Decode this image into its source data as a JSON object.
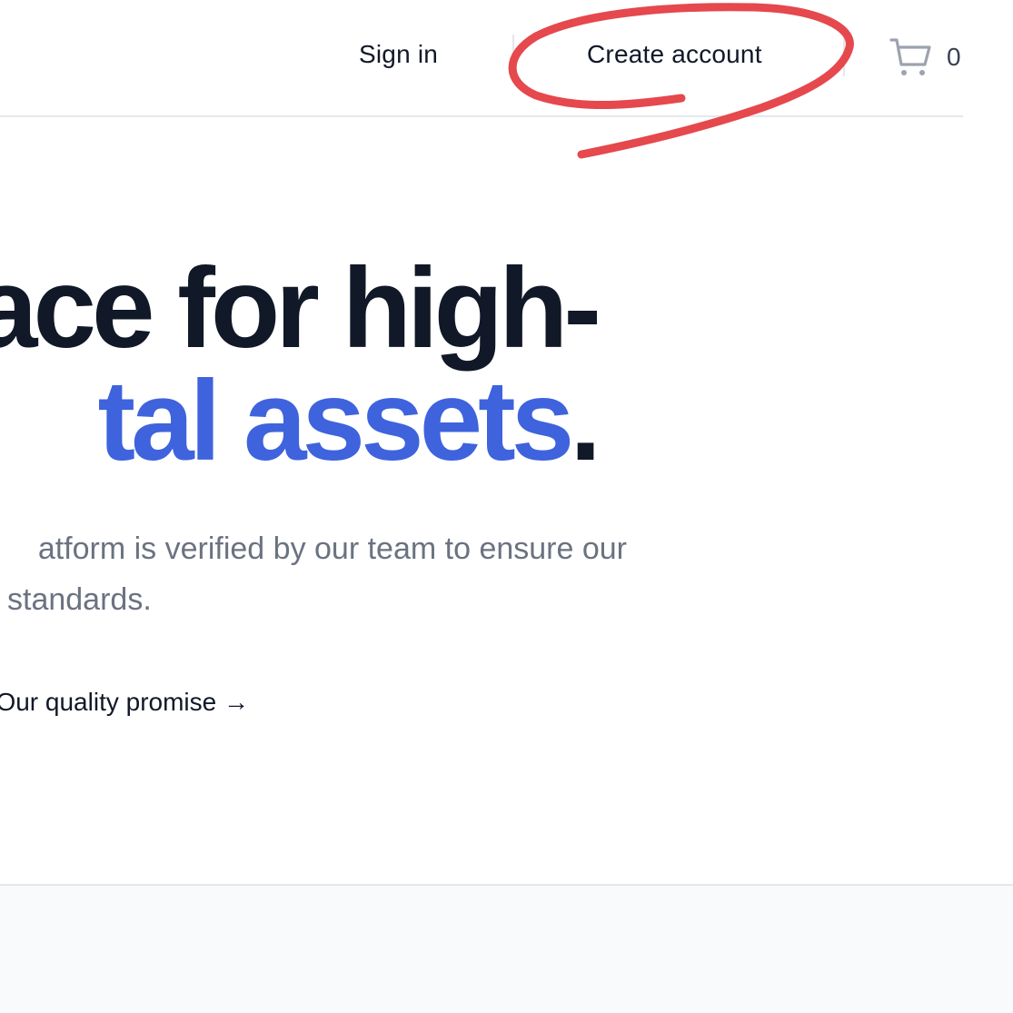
{
  "nav": {
    "signin_label": "Sign in",
    "create_account_label": "Create account",
    "cart_count": "0",
    "cart_icon": "shopping-cart-icon"
  },
  "hero": {
    "headline_line1": "lace for high-",
    "headline_line2_accent": "tal assets",
    "headline_line2_end": ".",
    "subtitle_line1": "atform is verified by our team to ensure our",
    "subtitle_line2": "standards.",
    "promise_link": "Our quality promise →"
  },
  "colors": {
    "accent": "#3e63dd",
    "heading": "#111827",
    "muted": "#6b7280",
    "annotation": "#e5484d"
  }
}
